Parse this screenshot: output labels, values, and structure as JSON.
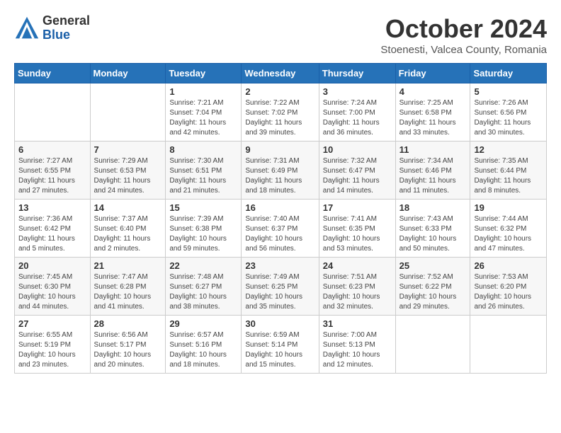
{
  "header": {
    "logo_general": "General",
    "logo_blue": "Blue",
    "month_title": "October 2024",
    "subtitle": "Stoenesti, Valcea County, Romania"
  },
  "weekdays": [
    "Sunday",
    "Monday",
    "Tuesday",
    "Wednesday",
    "Thursday",
    "Friday",
    "Saturday"
  ],
  "weeks": [
    [
      {
        "day": "",
        "info": ""
      },
      {
        "day": "",
        "info": ""
      },
      {
        "day": "1",
        "info": "Sunrise: 7:21 AM\nSunset: 7:04 PM\nDaylight: 11 hours and 42 minutes."
      },
      {
        "day": "2",
        "info": "Sunrise: 7:22 AM\nSunset: 7:02 PM\nDaylight: 11 hours and 39 minutes."
      },
      {
        "day": "3",
        "info": "Sunrise: 7:24 AM\nSunset: 7:00 PM\nDaylight: 11 hours and 36 minutes."
      },
      {
        "day": "4",
        "info": "Sunrise: 7:25 AM\nSunset: 6:58 PM\nDaylight: 11 hours and 33 minutes."
      },
      {
        "day": "5",
        "info": "Sunrise: 7:26 AM\nSunset: 6:56 PM\nDaylight: 11 hours and 30 minutes."
      }
    ],
    [
      {
        "day": "6",
        "info": "Sunrise: 7:27 AM\nSunset: 6:55 PM\nDaylight: 11 hours and 27 minutes."
      },
      {
        "day": "7",
        "info": "Sunrise: 7:29 AM\nSunset: 6:53 PM\nDaylight: 11 hours and 24 minutes."
      },
      {
        "day": "8",
        "info": "Sunrise: 7:30 AM\nSunset: 6:51 PM\nDaylight: 11 hours and 21 minutes."
      },
      {
        "day": "9",
        "info": "Sunrise: 7:31 AM\nSunset: 6:49 PM\nDaylight: 11 hours and 18 minutes."
      },
      {
        "day": "10",
        "info": "Sunrise: 7:32 AM\nSunset: 6:47 PM\nDaylight: 11 hours and 14 minutes."
      },
      {
        "day": "11",
        "info": "Sunrise: 7:34 AM\nSunset: 6:46 PM\nDaylight: 11 hours and 11 minutes."
      },
      {
        "day": "12",
        "info": "Sunrise: 7:35 AM\nSunset: 6:44 PM\nDaylight: 11 hours and 8 minutes."
      }
    ],
    [
      {
        "day": "13",
        "info": "Sunrise: 7:36 AM\nSunset: 6:42 PM\nDaylight: 11 hours and 5 minutes."
      },
      {
        "day": "14",
        "info": "Sunrise: 7:37 AM\nSunset: 6:40 PM\nDaylight: 11 hours and 2 minutes."
      },
      {
        "day": "15",
        "info": "Sunrise: 7:39 AM\nSunset: 6:38 PM\nDaylight: 10 hours and 59 minutes."
      },
      {
        "day": "16",
        "info": "Sunrise: 7:40 AM\nSunset: 6:37 PM\nDaylight: 10 hours and 56 minutes."
      },
      {
        "day": "17",
        "info": "Sunrise: 7:41 AM\nSunset: 6:35 PM\nDaylight: 10 hours and 53 minutes."
      },
      {
        "day": "18",
        "info": "Sunrise: 7:43 AM\nSunset: 6:33 PM\nDaylight: 10 hours and 50 minutes."
      },
      {
        "day": "19",
        "info": "Sunrise: 7:44 AM\nSunset: 6:32 PM\nDaylight: 10 hours and 47 minutes."
      }
    ],
    [
      {
        "day": "20",
        "info": "Sunrise: 7:45 AM\nSunset: 6:30 PM\nDaylight: 10 hours and 44 minutes."
      },
      {
        "day": "21",
        "info": "Sunrise: 7:47 AM\nSunset: 6:28 PM\nDaylight: 10 hours and 41 minutes."
      },
      {
        "day": "22",
        "info": "Sunrise: 7:48 AM\nSunset: 6:27 PM\nDaylight: 10 hours and 38 minutes."
      },
      {
        "day": "23",
        "info": "Sunrise: 7:49 AM\nSunset: 6:25 PM\nDaylight: 10 hours and 35 minutes."
      },
      {
        "day": "24",
        "info": "Sunrise: 7:51 AM\nSunset: 6:23 PM\nDaylight: 10 hours and 32 minutes."
      },
      {
        "day": "25",
        "info": "Sunrise: 7:52 AM\nSunset: 6:22 PM\nDaylight: 10 hours and 29 minutes."
      },
      {
        "day": "26",
        "info": "Sunrise: 7:53 AM\nSunset: 6:20 PM\nDaylight: 10 hours and 26 minutes."
      }
    ],
    [
      {
        "day": "27",
        "info": "Sunrise: 6:55 AM\nSunset: 5:19 PM\nDaylight: 10 hours and 23 minutes."
      },
      {
        "day": "28",
        "info": "Sunrise: 6:56 AM\nSunset: 5:17 PM\nDaylight: 10 hours and 20 minutes."
      },
      {
        "day": "29",
        "info": "Sunrise: 6:57 AM\nSunset: 5:16 PM\nDaylight: 10 hours and 18 minutes."
      },
      {
        "day": "30",
        "info": "Sunrise: 6:59 AM\nSunset: 5:14 PM\nDaylight: 10 hours and 15 minutes."
      },
      {
        "day": "31",
        "info": "Sunrise: 7:00 AM\nSunset: 5:13 PM\nDaylight: 10 hours and 12 minutes."
      },
      {
        "day": "",
        "info": ""
      },
      {
        "day": "",
        "info": ""
      }
    ]
  ]
}
